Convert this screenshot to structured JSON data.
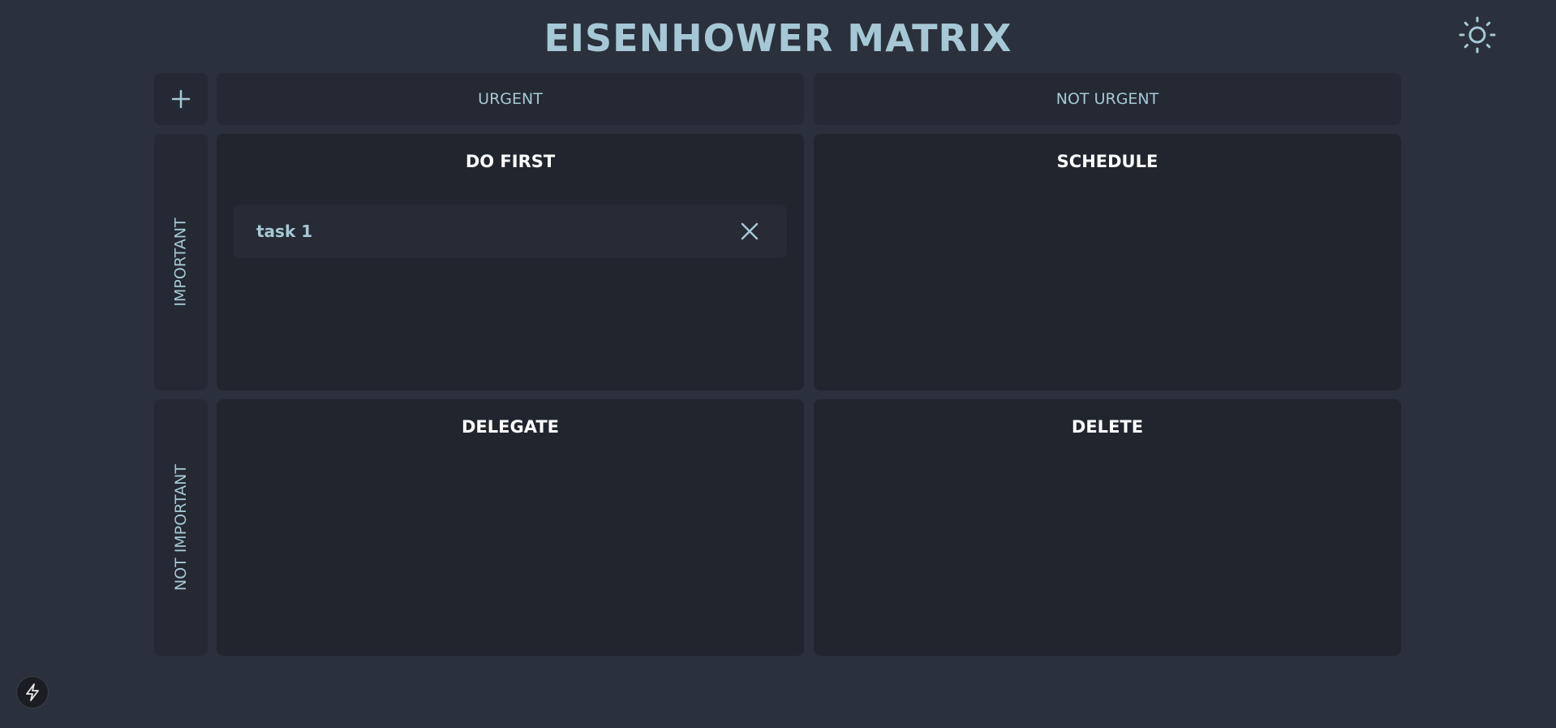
{
  "app": {
    "title": "EISENHOWER MATRIX"
  },
  "toolbar": {
    "theme_toggle_icon": "sun-icon",
    "add_task_icon": "plus-icon"
  },
  "columns": {
    "urgent": "URGENT",
    "not_urgent": "NOT URGENT"
  },
  "rows": {
    "important": "IMPORTANT",
    "not_important": "NOT IMPORTANT"
  },
  "quadrants": {
    "do_first": {
      "title": "DO FIRST",
      "tasks": [
        {
          "label": "task 1",
          "remove_icon": "close-icon"
        }
      ]
    },
    "schedule": {
      "title": "SCHEDULE",
      "tasks": []
    },
    "delegate": {
      "title": "DELEGATE",
      "tasks": []
    },
    "delete": {
      "title": "DELETE",
      "tasks": []
    }
  },
  "footer": {
    "dev_indicator_icon": "lightning-bolt-icon"
  },
  "colors": {
    "background": "#2a303c",
    "panel": "#242933",
    "quadrant": "#21252e",
    "accent_text": "#a6c8d6",
    "heading_text": "#ffffff"
  }
}
